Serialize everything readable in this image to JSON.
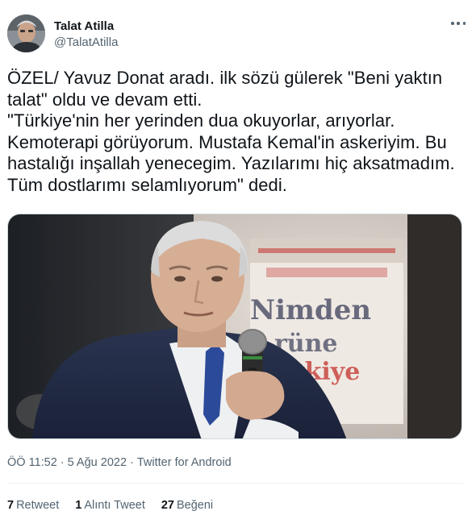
{
  "author": {
    "display_name": "Talat Atilla",
    "handle": "@TalatAtilla",
    "avatar_icon": "profile-photo"
  },
  "more_icon": "more-options-icon",
  "tweet_text": "ÖZEL/ Yavuz Donat aradı. ilk sözü gülerek \"Beni yaktın talat\" oldu ve devam etti.\n\"Türkiye'nin her yerinden dua okuyorlar, arıyorlar. Kemoterapi görüyorum. Mustafa Kemal'in askeriyim. Bu hastalığı inşallah yenecegim. Yazılarımı hiç aksatmadım. Tüm dostlarımı selamlıyorum\" dedi.",
  "media": {
    "backdrop_text": [
      "Nimden",
      "rüne",
      "ürkiye"
    ]
  },
  "meta": {
    "time": "ÖÖ 11:52",
    "separator": "·",
    "date": "5 Ağu 2022",
    "source": "Twitter for Android"
  },
  "stats": [
    {
      "count": "7",
      "label": "Retweet"
    },
    {
      "count": "1",
      "label": "Alıntı Tweet"
    },
    {
      "count": "27",
      "label": "Beğeni"
    }
  ],
  "colors": {
    "text_primary": "#0f1419",
    "text_secondary": "#536471",
    "divider": "#eff3f4",
    "backdrop_red": "#c4322b"
  }
}
